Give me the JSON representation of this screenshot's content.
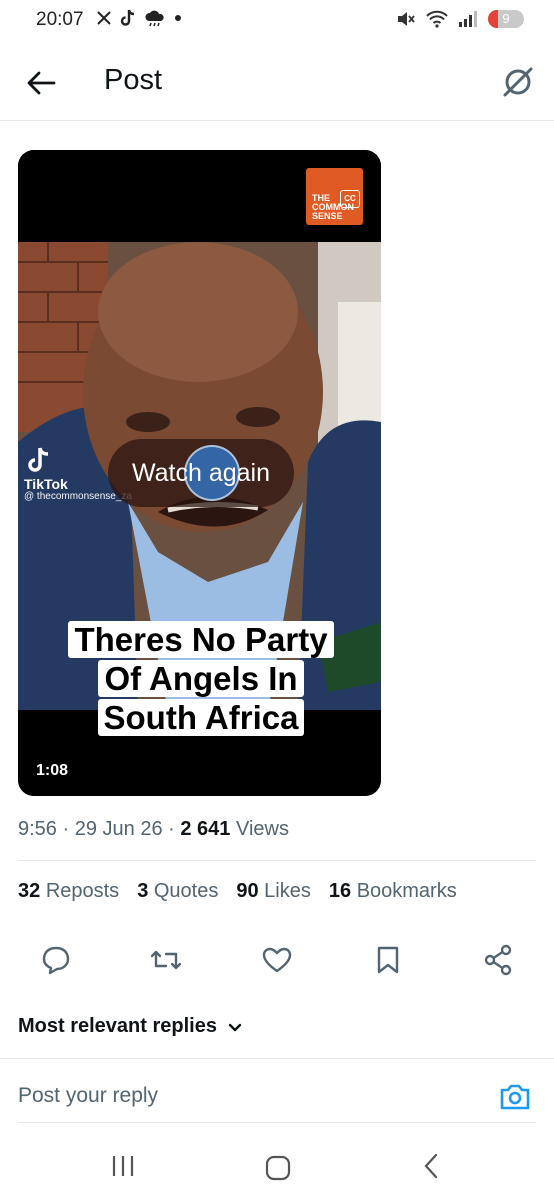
{
  "status_bar": {
    "time": "20:07",
    "left_icons": [
      "x-icon",
      "tiktok-icon",
      "cloud-icon",
      "dot-icon"
    ],
    "right_icons": [
      "mute-icon",
      "wifi-icon",
      "signal-icon"
    ],
    "battery": "9"
  },
  "header": {
    "title": "Post"
  },
  "video": {
    "logo_line1": "THE",
    "logo_line2": "COMMON",
    "logo_line3": "SENSE",
    "cc_badge": "CC",
    "tiktok_brand": "TikTok",
    "tiktok_handle": "@ thecommonsense_za",
    "watch_again": "Watch again",
    "caption": "Theres No Party Of Angels In South Africa",
    "duration": "1:08"
  },
  "meta": {
    "time": "9:56",
    "date": "29 Jun 26",
    "views_count": "2 641",
    "views_label": "Views"
  },
  "stats": {
    "reposts_count": "32",
    "reposts_label": "Reposts",
    "quotes_count": "3",
    "quotes_label": "Quotes",
    "likes_count": "90",
    "likes_label": "Likes",
    "bookmarks_count": "16",
    "bookmarks_label": "Bookmarks"
  },
  "replies": {
    "sort_label": "Most relevant replies",
    "reply_placeholder": "Post your reply"
  },
  "colors": {
    "accent": "#1d9bf0",
    "logo_orange": "#e05a23",
    "secondary_text": "#536471"
  }
}
